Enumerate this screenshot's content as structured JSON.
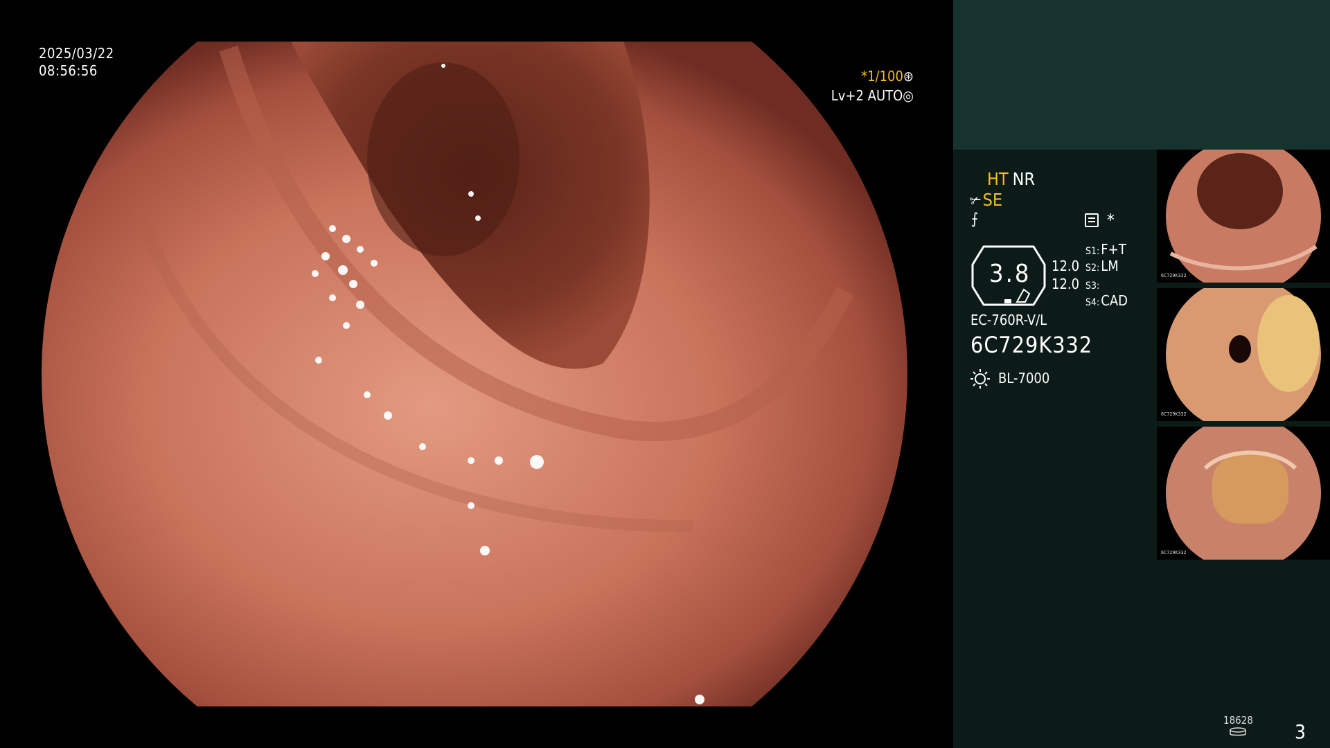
{
  "overlay": {
    "date": "2025/03/22",
    "time": "08:56:56",
    "shutter": "*1/100",
    "level": "Lv+2 AUTO"
  },
  "panel": {
    "mode_ht": "HT",
    "mode_nr": "NR",
    "mode_se": "SE",
    "star": "*",
    "gauge_value": "3.8",
    "gauge_a": "12.0",
    "gauge_b": "12.0",
    "switches": [
      {
        "key": "S1:",
        "value": "F+T"
      },
      {
        "key": "S2:",
        "value": "LM"
      },
      {
        "key": "S3:",
        "value": ""
      },
      {
        "key": "S4:",
        "value": "CAD"
      }
    ],
    "scope_model": "EC-760R-V/L",
    "scope_serial": "6C729K332",
    "light_source": "BL-7000",
    "thumb_serial": "6C729K332",
    "image_counter": "18628",
    "page_number": "3"
  },
  "colors": {
    "accent_yellow": "#f0c020",
    "panel_bg": "#0c1b18",
    "panel_top": "#163330",
    "mucosa": "#c26a52"
  }
}
